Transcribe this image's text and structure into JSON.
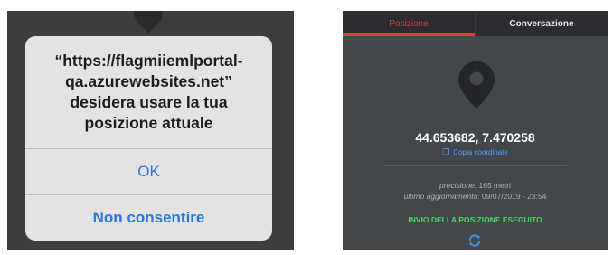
{
  "permission_dialog": {
    "message": "“https://flagmiiemlportal-\nqa.azurewebsites.net”\ndesidera usare la tua\nposizione attuale",
    "ok_label": "OK",
    "deny_label": "Non consentire"
  },
  "location_screen": {
    "tabs": [
      {
        "label": "Posizione",
        "active": true
      },
      {
        "label": "Conversazione",
        "active": false
      }
    ],
    "pin_icon": "map-pin-icon",
    "coordinates": "44.653682, 7.470258",
    "copy_label": "Copia coordinate",
    "precision_label": "precisione:",
    "precision_value": "165 metri",
    "last_update_label": "ultimo aggiornamento:",
    "last_update_value": "09/07/2019 - 23:54",
    "status_text": "INVIO DELLA POSIZIONE ESEGUITO",
    "refresh_icon": "refresh-icon"
  },
  "colors": {
    "accent_red": "#e0393e",
    "link_blue": "#4aa3ff",
    "ios_blue": "#2778e0",
    "success_green": "#4cd964"
  }
}
